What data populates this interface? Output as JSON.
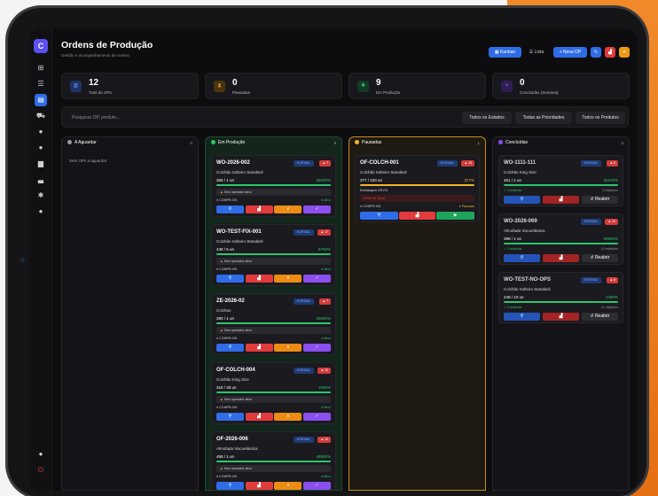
{
  "header": {
    "title": "Ordens de Produção",
    "subtitle": "Gestão e acompanhamento de ordens",
    "kanban_label": "Kanban",
    "lista_label": "Lista",
    "nova_op_label": "+  Nova OP"
  },
  "stats": [
    {
      "value": "12",
      "label": "Total de OPs",
      "color": "#3b6be8"
    },
    {
      "value": "0",
      "label": "Pausadas",
      "color": "#e8a02a"
    },
    {
      "value": "9",
      "label": "Em Produção",
      "color": "#2cc66c"
    },
    {
      "value": "0",
      "label": "Concluídas (Semana)",
      "color": "#8b4ff0"
    }
  ],
  "filters": {
    "search_placeholder": "Pesquisar OP, produto...",
    "estados": "Todos os Estados",
    "prioridades": "Todas as Prioridades",
    "produtos": "Todos os Produtos"
  },
  "columns": {
    "aguardar": {
      "title": "A Aguardar",
      "count": "0",
      "empty": "Sem OPs a aguardar"
    },
    "producao": {
      "title": "Em Produção",
      "count": "9"
    },
    "pausadas": {
      "title": "Pausadas",
      "count": "1"
    },
    "concluidas": {
      "title": "Concluídas",
      "count": "3"
    }
  },
  "cards_producao": [
    {
      "id": "WO-2026-002",
      "priority": "NORMAL",
      "risk": "7",
      "product": "Colchão Solteiro Standard",
      "qty": "365 / 1 un",
      "pct": "36500%",
      "warning": "Sem operador ativo",
      "operator": "COMPR-001",
      "active": "Ativo"
    },
    {
      "id": "WO-TEST-FIX-001",
      "priority": "NORMAL",
      "risk": "17",
      "product": "Colchão Solteiro Standard",
      "qty": "438 / 5 un",
      "pct": "8760%",
      "warning": "Sem operador ativo",
      "operator": "COMPR-001",
      "active": "Ativo"
    },
    {
      "id": "ZE-2026-02",
      "priority": "NORMAL",
      "risk": "7",
      "product": "Colchao",
      "qty": "390 / 1 un",
      "pct": "39000%",
      "warning": "Sem operador ativo",
      "operator": "COMPR-001",
      "active": "Ativo"
    },
    {
      "id": "OF-COLCH-004",
      "priority": "NORMAL",
      "risk": "15",
      "product": "Colchão King Size",
      "qty": "318 / 30 un",
      "pct": "1060%",
      "warning": "Sem operador ativo",
      "operator": "COMPR-001",
      "active": "Ativo"
    },
    {
      "id": "OF-2026-006",
      "priority": "NORMAL",
      "risk": "15",
      "product": "Almofada Viscoelástica",
      "qty": "458 / 1 un",
      "pct": "45800%",
      "warning": "Sem operador ativo",
      "operator": "COMPR-001",
      "active": "Ativo"
    }
  ],
  "card_pausada": {
    "id": "OF-COLCH-001",
    "priority": "NORMAL",
    "risk": "15",
    "product": "Colchão Solteiro Standard",
    "qty": "377 / 100 un",
    "pct": "377%",
    "note": "Embalagem DEV01",
    "reason": "Fim de Turno",
    "operator": "COMPR-001",
    "status": "Pausado"
  },
  "cards_concluidas": [
    {
      "id": "WO-1111-111",
      "priority": "NORMAL",
      "risk": "6",
      "product": "Colchão King Size",
      "qty": "451 / 1 un",
      "pct": "45100%",
      "status": "Concluída",
      "rejects": "0 rejeições",
      "reopen": "Reabrir"
    },
    {
      "id": "WO-2026-069",
      "priority": "NORMAL",
      "risk": "10",
      "product": "Almofada Viscoelástica",
      "qty": "399 / 1 un",
      "pct": "39900%",
      "status": "Concluída",
      "rejects": "10 rejeições",
      "reopen": "Reabrir"
    },
    {
      "id": "WO-TEST-NO-OPS",
      "priority": "NORMAL",
      "risk": "6",
      "product": "Colchão Solteiro Standard",
      "qty": "248 / 10 un",
      "pct": "2480%",
      "status": "Concluída",
      "rejects": "11 rejeições",
      "reopen": "Reabrir"
    }
  ]
}
